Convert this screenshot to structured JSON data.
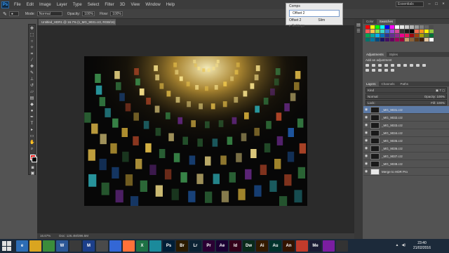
{
  "menu": {
    "logo": "Ps",
    "items": [
      "File",
      "Edit",
      "Image",
      "Layer",
      "Type",
      "Select",
      "Filter",
      "3D",
      "View",
      "Window",
      "Help"
    ],
    "workspace": "Essentials"
  },
  "options": {
    "mode_label": "Mode:",
    "mode_value": "Normal",
    "opacity_label": "Opacity:",
    "opacity_value": "100%",
    "flow_label": "Flow:",
    "flow_value": "100%"
  },
  "comps": {
    "title": "Comps",
    "selected": "Offset 2",
    "row_left": "Offset 2",
    "row_right": "Slim",
    "settings": "Settings"
  },
  "document": {
    "tab_title": "Untitled_HDR1 @ 16.7% (1_MG_9031.cr2, RGB/16) *",
    "zoom": "16.67%",
    "doc_info": "Doc: 126.4M/396.5M"
  },
  "panels": {
    "swatch_tabs": [
      "Color",
      "Swatches"
    ],
    "adj_tabs": [
      "Adjustments",
      "Styles"
    ],
    "adj_title": "Add an adjustment",
    "layer_tabs": [
      "Layers",
      "Channels",
      "Paths"
    ],
    "kind_label": "Kind",
    "blend_mode": "Normal",
    "opacity_label": "Opacity:",
    "opacity_value": "100%",
    "lock_label": "Lock:",
    "fill_label": "Fill:",
    "fill_value": "100%",
    "layers": [
      {
        "name": "_MG_9031.cr2",
        "selected": true
      },
      {
        "name": "_MG_9032.cr2",
        "selected": false
      },
      {
        "name": "_MG_9033.cr2",
        "selected": false
      },
      {
        "name": "_MG_9034.cr2",
        "selected": false
      },
      {
        "name": "_MG_9035.cr2",
        "selected": false
      },
      {
        "name": "_MG_9036.cr2",
        "selected": false
      },
      {
        "name": "_MG_9037.cr2",
        "selected": false
      },
      {
        "name": "_MG_9038.cr2",
        "selected": false
      },
      {
        "name": "Merge to HDR Pro",
        "selected": false
      }
    ]
  },
  "taskbar": {
    "time": "23:40",
    "date": "21/02/2016",
    "apps": [
      {
        "label": "e",
        "color": "#2d6db5"
      },
      {
        "label": "",
        "color": "#d9a520"
      },
      {
        "label": "",
        "color": "#3b8c3b"
      },
      {
        "label": "W",
        "color": "#2b5797"
      },
      {
        "label": "",
        "color": "#3a3a3a"
      },
      {
        "label": "M",
        "color": "#1c3f8a"
      },
      {
        "label": "",
        "color": "#4a4a4a"
      },
      {
        "label": "",
        "color": "#3367d6"
      },
      {
        "label": "",
        "color": "#ff7139"
      },
      {
        "label": "X",
        "color": "#1e7145"
      },
      {
        "label": "",
        "color": "#1b8a9b"
      },
      {
        "label": "Ps",
        "color": "#001e36"
      },
      {
        "label": "Br",
        "color": "#2b1b00"
      },
      {
        "label": "Lr",
        "color": "#0a2233"
      },
      {
        "label": "Pr",
        "color": "#2a0033"
      },
      {
        "label": "Ae",
        "color": "#1a0033"
      },
      {
        "label": "Id",
        "color": "#33001a"
      },
      {
        "label": "Dw",
        "color": "#0a2a1a"
      },
      {
        "label": "Ai",
        "color": "#331a00"
      },
      {
        "label": "Au",
        "color": "#00332b"
      },
      {
        "label": "An",
        "color": "#331400"
      },
      {
        "label": "",
        "color": "#c13b2b"
      },
      {
        "label": "Me",
        "color": "#1a1a33"
      },
      {
        "label": "",
        "color": "#7a1ea1"
      },
      {
        "label": "",
        "color": "#333333"
      }
    ]
  },
  "colors": {
    "foreground": "#e01010",
    "background": "#000000",
    "accent": "#5c7aa6"
  }
}
